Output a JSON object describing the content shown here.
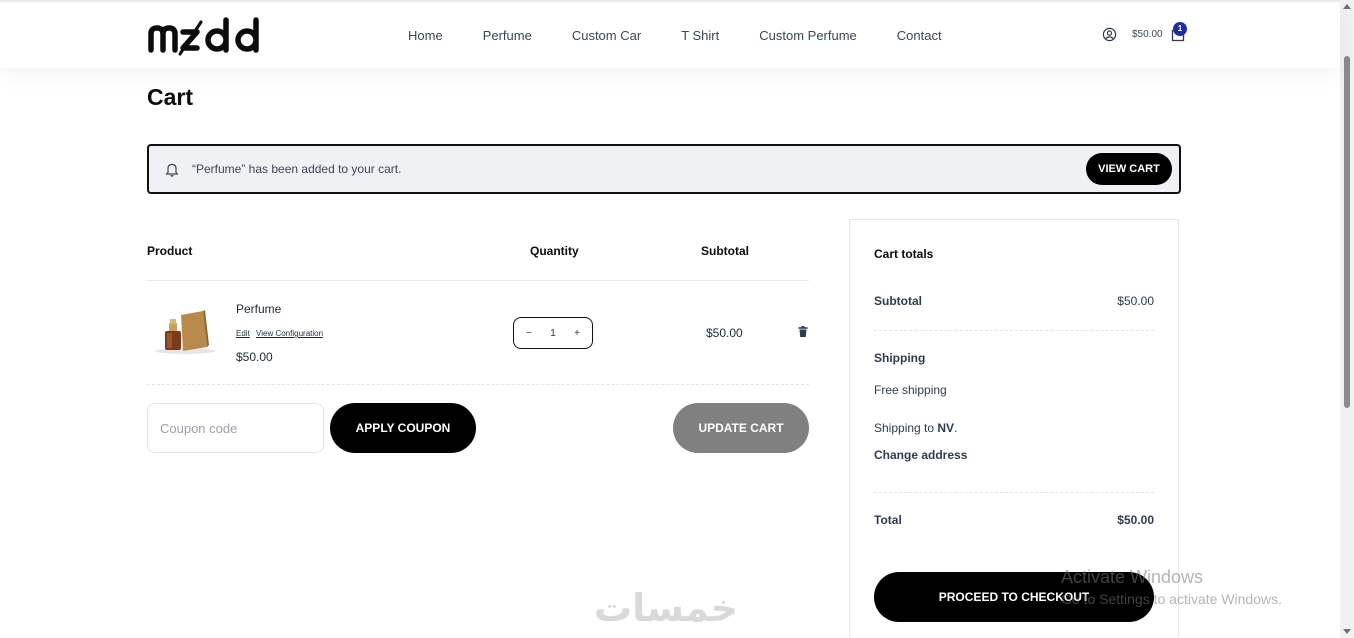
{
  "header": {
    "logo_text": "mzdd",
    "nav": [
      "Home",
      "Perfume",
      "Custom Car",
      "T Shirt",
      "Custom Perfume",
      "Contact"
    ],
    "cart_total": "$50.00",
    "cart_count": "1"
  },
  "page_title": "Cart",
  "notice": {
    "message": "“Perfume” has been added to your cart.",
    "button": "VIEW CART"
  },
  "table": {
    "headers": {
      "product": "Product",
      "quantity": "Quantity",
      "subtotal": "Subtotal"
    },
    "items": [
      {
        "name": "Perfume",
        "edit": "Edit",
        "view_config": "View Configuration",
        "price": "$50.00",
        "qty_minus": "−",
        "quantity": "1",
        "qty_plus": "+",
        "subtotal": "$50.00"
      }
    ]
  },
  "coupon": {
    "placeholder": "Coupon code",
    "apply": "APPLY COUPON",
    "update": "UPDATE CART"
  },
  "totals": {
    "title": "Cart totals",
    "subtotal_label": "Subtotal",
    "subtotal_value": "$50.00",
    "shipping_label": "Shipping",
    "shipping_method": "Free shipping",
    "shipping_to_prefix": "Shipping to ",
    "shipping_to_region": "NV",
    "shipping_to_suffix": ".",
    "change_address": "Change address",
    "total_label": "Total",
    "total_value": "$50.00",
    "checkout": "PROCEED TO CHECKOUT"
  },
  "watermark": "خمسات",
  "os_overlay": {
    "line1": "Activate Windows",
    "line2": "Go to Settings to activate Windows."
  },
  "colors": {
    "accent": "#000000",
    "badge": "#1f2ca8",
    "update_button": "#808080",
    "notice_bg": "#eff1f4"
  }
}
